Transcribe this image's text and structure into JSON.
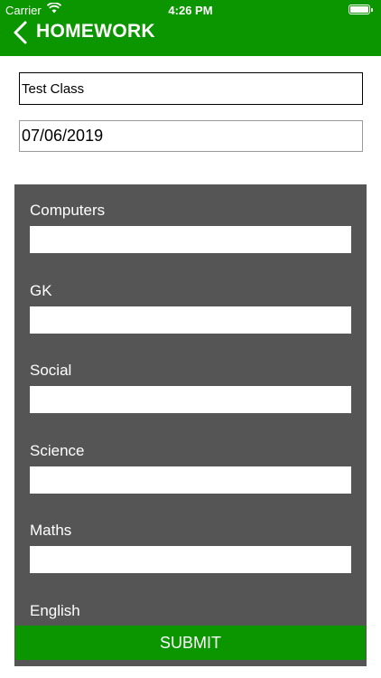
{
  "status_bar": {
    "carrier": "Carrier",
    "time": "4:26 PM"
  },
  "header": {
    "title": "HOMEWORK",
    "back_icon": "chevron-left-icon"
  },
  "form": {
    "class_value": "Test Class",
    "date_value": "07/06/2019"
  },
  "subjects": [
    {
      "label": "Computers",
      "value": ""
    },
    {
      "label": "GK",
      "value": ""
    },
    {
      "label": "Social",
      "value": ""
    },
    {
      "label": "Science",
      "value": ""
    },
    {
      "label": "Maths",
      "value": ""
    },
    {
      "label": "English",
      "value": ""
    }
  ],
  "submit_label": "SUBMIT",
  "colors": {
    "accent": "#0b9600",
    "panel": "#555555"
  }
}
